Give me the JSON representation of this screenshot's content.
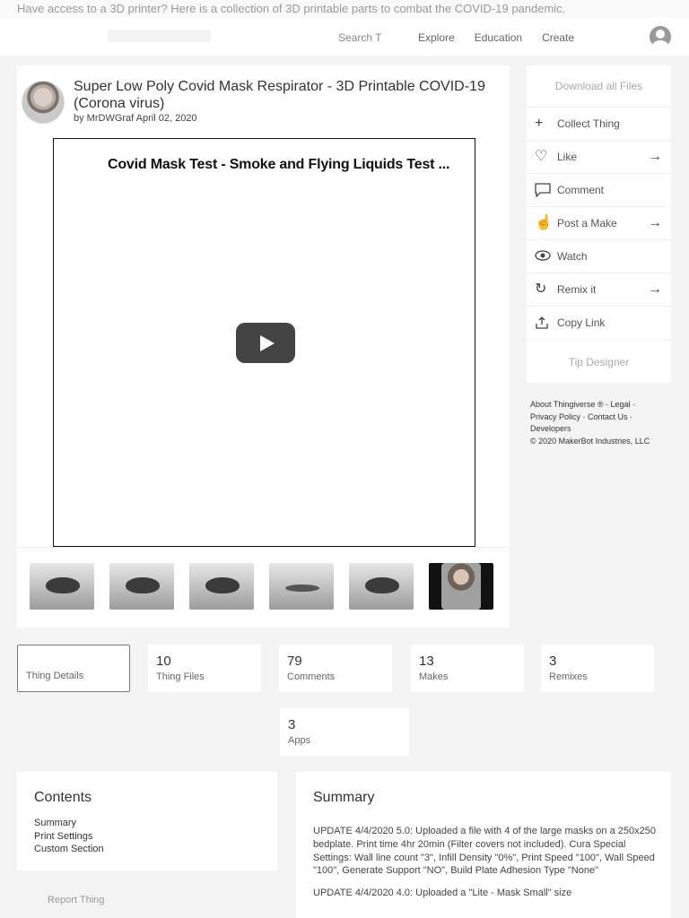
{
  "banner": {
    "text": "Have access to a 3D printer? Here is a collection of 3D printable parts to combat the COVID-19 pandemic."
  },
  "nav": {
    "search_label": "Search T",
    "links": [
      "Explore",
      "Education",
      "Create"
    ]
  },
  "thing": {
    "title": "Super Low Poly Covid Mask Respirator - 3D Printable COVID-19 (Corona virus)",
    "byline": "by MrDWGraf April 02, 2020",
    "video_title": "Covid Mask Test - Smoke and Flying Liquids Test ..."
  },
  "sidebar": {
    "download": "Download all Files",
    "collect": "Collect Thing",
    "like": "Like",
    "comment": "Comment",
    "post_make": "Post a Make",
    "watch": "Watch",
    "remix": "Remix it",
    "copy_link": "Copy Link",
    "tip": "Tip Designer"
  },
  "footer": {
    "about": "About Thingiverse ®",
    "legal": "Legal",
    "privacy": "Privacy Policy",
    "contact": "Contact Us",
    "developers": "Developers",
    "copyright": "© 2020 MakerBot Industries, LLC"
  },
  "stats": {
    "details": "Thing Details",
    "files_count": "10",
    "files_label": "Thing Files",
    "comments_count": "79",
    "comments_label": "Comments",
    "makes_count": "13",
    "makes_label": "Makes",
    "remixes_count": "3",
    "remixes_label": "Remixes",
    "apps_count": "3",
    "apps_label": "Apps"
  },
  "contents": {
    "title": "Contents",
    "items": [
      "Summary",
      "Print Settings",
      "Custom Section"
    ]
  },
  "summary": {
    "title": "Summary",
    "para1": "UPDATE 4/4/2020 5.0: Uploaded a file with 4 of the large masks on a 250x250 bedplate. Print time 4hr 20min (Filter covers not included). Cura Special Settings: Wall line count \"3\", Infill Density \"0%\", Print Speed \"100\", Wall Speed \"100\", Generate Support \"NO\", Build Plate Adhesion Type \"None\"",
    "para2": "UPDATE 4/4/2020 4.0: Uploaded a \"Lite - Mask Small\" size"
  },
  "report": "Report Thing"
}
